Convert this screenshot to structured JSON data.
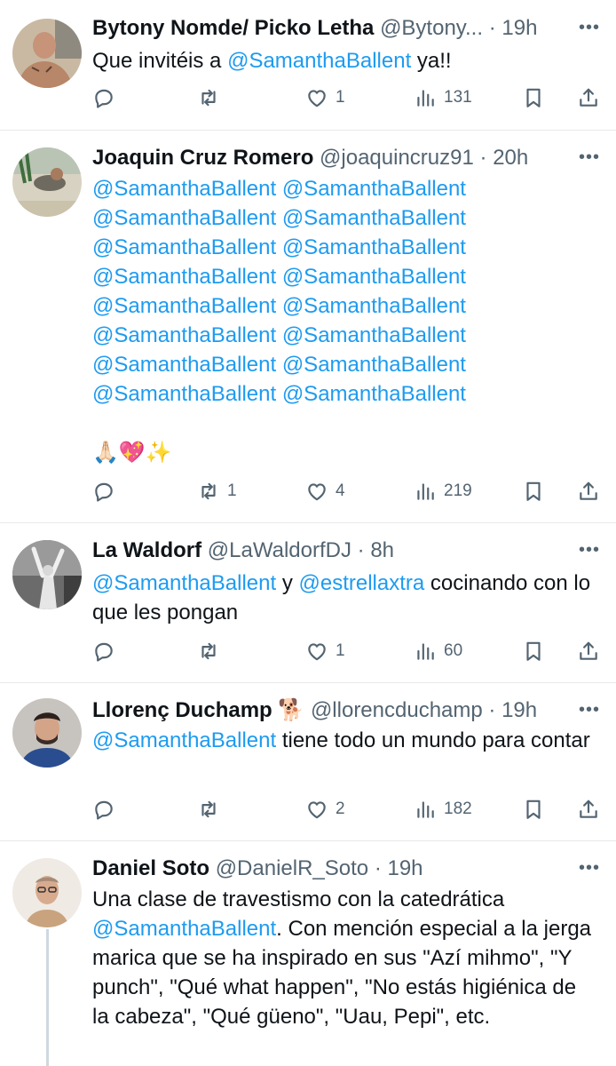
{
  "tweets": [
    {
      "name": "Bytony Nomde/ Picko Letha",
      "handle": "@Bytony...",
      "dot": "·",
      "time": "19h",
      "text_parts": [
        "Que invitéis a ",
        "@SamanthaBallent",
        " ya!!"
      ],
      "replies": "",
      "retweets": "",
      "likes": "1",
      "views": "131"
    },
    {
      "name": "Joaquin Cruz Romero",
      "handle": "@joaquincruz91",
      "dot": "·",
      "time": "20h",
      "mention_lines": [
        "@SamanthaBallent @SamanthaBallent",
        "@SamanthaBallent @SamanthaBallent",
        "@SamanthaBallent @SamanthaBallent",
        "@SamanthaBallent @SamanthaBallent",
        "@SamanthaBallent @SamanthaBallent",
        "@SamanthaBallent @SamanthaBallent",
        "@SamanthaBallent @SamanthaBallent",
        "@SamanthaBallent @SamanthaBallent"
      ],
      "emojis": "🙏🏻💖✨",
      "replies": "",
      "retweets": "1",
      "likes": "4",
      "views": "219"
    },
    {
      "name": "La Waldorf",
      "handle": "@LaWaldorfDJ",
      "dot": "·",
      "time": "8h",
      "text_parts": [
        "@SamanthaBallent",
        " y ",
        "@estrellaxtra",
        " cocinando con lo que les pongan"
      ],
      "replies": "",
      "retweets": "",
      "likes": "1",
      "views": "60"
    },
    {
      "name": "Llorenç Duchamp",
      "name_emoji": "🐕",
      "handle": "@llorencduchamp",
      "dot": "·",
      "time": "19h",
      "text_parts": [
        "@SamanthaBallent",
        " tiene todo un mundo para contar"
      ],
      "replies": "",
      "retweets": "",
      "likes": "2",
      "views": "182"
    },
    {
      "name": "Daniel Soto",
      "handle": "@DanielR_Soto",
      "dot": "·",
      "time": "19h",
      "text_parts": [
        "Una clase de travestismo con la catedrática ",
        "@SamanthaBallent",
        ". Con mención especial a la jerga marica que se ha inspirado en sus \"Azí mihmo\", \"Y punch\", \"Qué what happen\", \"No estás higiénica de la cabeza\", \"Qué güeno\", \"Uau, Pepi\", etc."
      ]
    }
  ],
  "more_glyph": "•••",
  "icons": [
    "reply-icon",
    "retweet-icon",
    "like-icon",
    "views-icon",
    "bookmark-icon",
    "share-icon",
    "more-icon"
  ],
  "colors": {
    "mention": "#1d9bf0",
    "secondary": "#536471",
    "divider": "#e7e9ea"
  }
}
